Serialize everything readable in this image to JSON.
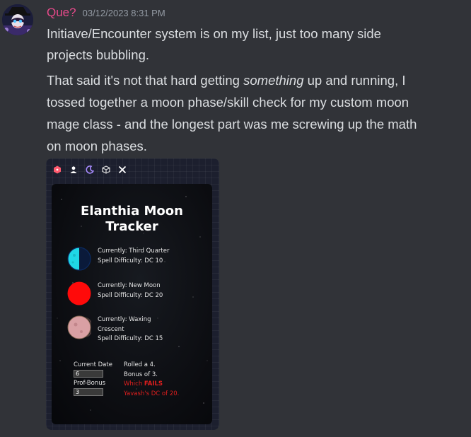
{
  "message": {
    "username": "Que?",
    "timestamp": "03/12/2023 8:31 PM",
    "lines": [
      "Initiave/Encounter system is on my list, just too many side",
      "projects bubbling.",
      "That said it's not that hard getting ",
      "something",
      " up and running, I",
      "tossed together a moon phase/skill check for my custom moon",
      "mage class - and the longest part was me screwing up the math",
      "on moon phases."
    ]
  },
  "colors": {
    "username": "#e84a8b",
    "background": "#313338",
    "fail_red": "#e01e1e",
    "moon_cyan": "#1fd6e6",
    "moon_red": "#ff0a0a",
    "moon_pink": "#d9a0a4"
  },
  "embed": {
    "toolbar_icons": [
      "dice-icon",
      "user-icon",
      "moon-icon",
      "cube-icon",
      "crossed-swords-icon"
    ],
    "title_line1": "Elanthia Moon",
    "title_line2": "Tracker",
    "moons": [
      {
        "status": "Currently: Third Quarter",
        "difficulty": "Spell Difficulty: DC 10",
        "icon": "half-moon-icon"
      },
      {
        "status": "Currently: New Moon",
        "difficulty": "Spell Difficulty: DC 20",
        "icon": "full-red-moon-icon"
      },
      {
        "status_line1": "Currently: Waxing",
        "status_line2": "Crescent",
        "difficulty": "Spell Difficulty: DC 15",
        "icon": "crescent-moon-icon"
      }
    ],
    "form": {
      "date_label": "Current Date",
      "date_value": "6",
      "prof_label": "Prof-Bonus",
      "prof_value": "3"
    },
    "results": {
      "rolled": "Rolled a 4.",
      "bonus": "Bonus of 3.",
      "which": "Which ",
      "fails": "FAILS",
      "dc": "Yavash's DC of 20."
    }
  }
}
